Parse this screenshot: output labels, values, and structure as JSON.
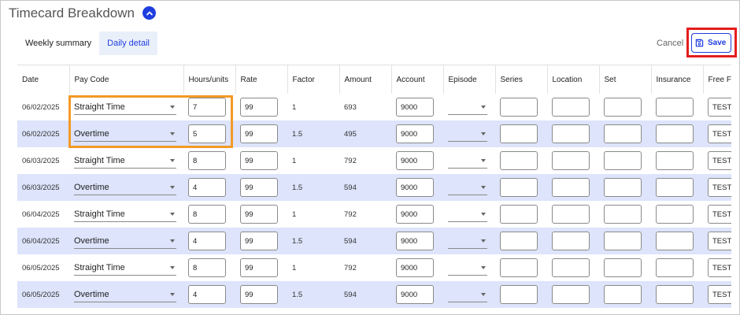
{
  "header": {
    "title": "Timecard Breakdown"
  },
  "tabs": [
    {
      "label": "Weekly summary",
      "active": false
    },
    {
      "label": "Daily detail",
      "active": true
    }
  ],
  "actions": {
    "cancel_label": "Cancel",
    "save_label": "Save"
  },
  "colors": {
    "accent": "#1f3ee0",
    "row_alt": "#dde4fb",
    "save_highlight": "#e51c1c",
    "hours_highlight": "#f39a26"
  },
  "table": {
    "columns": [
      "Date",
      "Pay Code",
      "Hours/units",
      "Rate",
      "Factor",
      "Amount",
      "Account",
      "Episode",
      "Series",
      "Location",
      "Set",
      "Insurance",
      "Free Fie"
    ],
    "rows": [
      {
        "date": "06/02/2025",
        "pay_code": "Straight Time",
        "hours": "7",
        "rate": "99",
        "factor": "1",
        "amount": "693",
        "account": "9000",
        "free_field": "TEST"
      },
      {
        "date": "06/02/2025",
        "pay_code": "Overtime",
        "hours": "5",
        "rate": "99",
        "factor": "1.5",
        "amount": "495",
        "account": "9000",
        "free_field": "TEST"
      },
      {
        "date": "06/03/2025",
        "pay_code": "Straight Time",
        "hours": "8",
        "rate": "99",
        "factor": "1",
        "amount": "792",
        "account": "9000",
        "free_field": "TEST"
      },
      {
        "date": "06/03/2025",
        "pay_code": "Overtime",
        "hours": "4",
        "rate": "99",
        "factor": "1.5",
        "amount": "594",
        "account": "9000",
        "free_field": "TEST"
      },
      {
        "date": "06/04/2025",
        "pay_code": "Straight Time",
        "hours": "8",
        "rate": "99",
        "factor": "1",
        "amount": "792",
        "account": "9000",
        "free_field": "TEST"
      },
      {
        "date": "06/04/2025",
        "pay_code": "Overtime",
        "hours": "4",
        "rate": "99",
        "factor": "1.5",
        "amount": "594",
        "account": "9000",
        "free_field": "TEST"
      },
      {
        "date": "06/05/2025",
        "pay_code": "Straight Time",
        "hours": "8",
        "rate": "99",
        "factor": "1",
        "amount": "792",
        "account": "9000",
        "free_field": "TEST"
      },
      {
        "date": "06/05/2025",
        "pay_code": "Overtime",
        "hours": "4",
        "rate": "99",
        "factor": "1.5",
        "amount": "594",
        "account": "9000",
        "free_field": "TEST"
      }
    ]
  }
}
